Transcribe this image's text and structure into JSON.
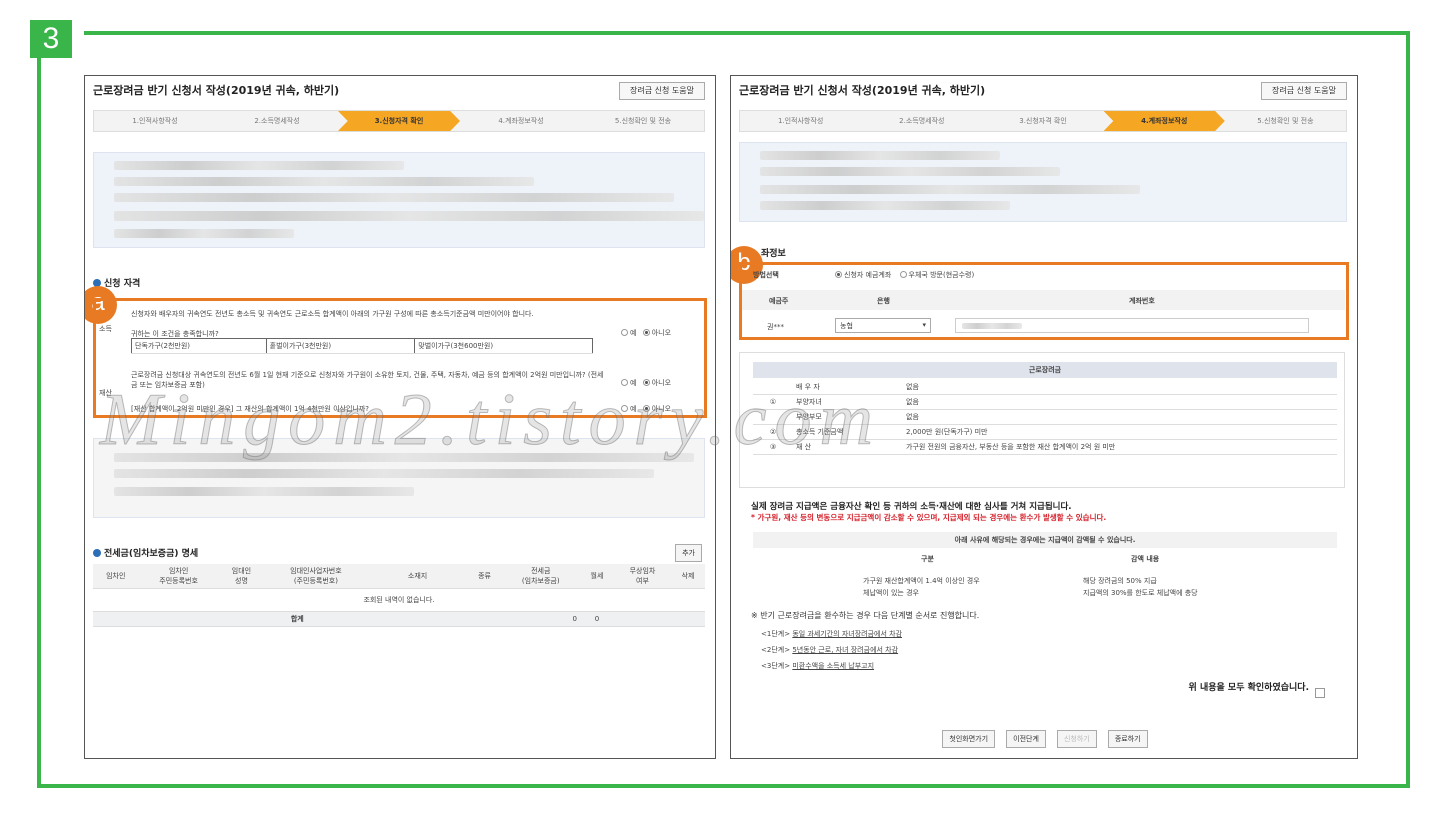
{
  "step_badge": "3",
  "left": {
    "title": "근로장려금 반기 신청서 작성(2019년 귀속, 하반기)",
    "help_button": "장려금 신청 도움말",
    "steps": [
      "1.인적사항작성",
      "2.소득명세작성",
      "3.신청자격 확인",
      "4.계좌정보작성",
      "5.신청확인 및 전송"
    ],
    "active_step": 2,
    "section_qualification": "신청 자격",
    "callout": "a",
    "income_label": "소득",
    "income_q": "신청자와 배우자의 귀속연도 전년도 총소득 및 귀속연도 근로소득 합계액이 아래의 가구원 구성에 따른 총소득기준금액 미만이어야 합니다.",
    "income_q2": "귀하는 이 조건을 충족합니까?",
    "household_cols": [
      "단독가구(2천만원)",
      "홑벌이가구(3천만원)",
      "맞벌이가구(3천600만원)"
    ],
    "property_label": "재산",
    "property_q": "근로장려금 신청대상 귀속연도의 전년도 6월 1일 현재 기준으로 신청자와 가구원이 소유한 토지, 건물, 주택, 자동차, 예금 등의 합계액이 2억원 미만입니까? (전세금 또는 임차보증금 포함)",
    "property_q2": "[재산 합계액이 2억원 미만인 경우] 그 재산의 합계액이 1억 4천만원 이상입니까?",
    "yes": "예",
    "no": "아니오",
    "section_lease": "전세금(임차보증금) 명세",
    "add_button": "추가",
    "lease_cols": [
      "임차인",
      "임차인\n주민등록번호",
      "임대인\n성명",
      "임대인사업자번호\n(주민등록번호)",
      "소재지",
      "종류",
      "전세금\n(임차보증금)",
      "월세",
      "무상임차\n여부",
      "삭제"
    ],
    "lease_empty": "조회된 내역이 없습니다.",
    "total_label": "합계",
    "total_v1": "0",
    "total_v2": "0"
  },
  "right": {
    "title": "근로장려금 반기 신청서 작성(2019년 귀속, 하반기)",
    "help_button": "장려금 신청 도움말",
    "steps": [
      "1.인적사항작성",
      "2.소득명세작성",
      "3.신청자격 확인",
      "4.계좌정보작성",
      "5.신청확인 및 전송"
    ],
    "active_step": 3,
    "account_section": "좌정보",
    "callout": "b",
    "method_label": "방법선택",
    "method_opt1": "신청자 예금계좌",
    "method_opt2": "우체국 방문(현금수령)",
    "depositor_col": "예금주",
    "bank_col": "은행",
    "account_col": "계좌번호",
    "depositor_val": "권***",
    "bank_val": "농협",
    "summary_header": "근로장려금",
    "summary_rows": [
      {
        "no": "",
        "label": "배 우 자",
        "value": "없음"
      },
      {
        "no": "①",
        "label": "부양자녀",
        "value": "없음"
      },
      {
        "no": "",
        "label": "부양부모",
        "value": "없음"
      },
      {
        "no": "②",
        "label": "총소득 기준금액",
        "value": "2,000만 원(단독가구) 미만"
      },
      {
        "no": "③",
        "label": "재    산",
        "value": "가구원 전원의 금융자산, 부동산 등을 포함한 재산 합계액이 2억 원 미만"
      }
    ],
    "notice1": "실제 장려금 지급액은 금융자산 확인 등 귀하의 소득·재산에 대한 심사를 거쳐 지급됩니다.",
    "notice2": "* 가구원, 재산 등의 변동으로 지급금액이 감소할 수 있으며, 지급제외 되는 경우에는 환수가 발생할 수 있습니다.",
    "reduce_title": "아래 사유에 해당되는 경우에는 지급액이 감액될 수 있습니다.",
    "reduce_col1": "구분",
    "reduce_col2": "감액 내용",
    "reduce_r1_c1": "가구원 재산합계액이 1.4억 이상인 경우",
    "reduce_r1_c2": "해당 장려금의 50% 지급",
    "reduce_r2_c1": "체납액이 있는 경우",
    "reduce_r2_c2": "지급액의 30%를 한도로 체납액에 충당",
    "refund_title": "※ 반기 근로장려금을 환수하는 경우 다음 단계별 순서로 진행합니다.",
    "stage1_label": "<1단계>",
    "stage1_text": "동일 과세기간의 자녀장려금에서 차감",
    "stage2_label": "<2단계>",
    "stage2_text": "5년동안 근로, 자녀 장려금에서 차감",
    "stage3_label": "<3단계>",
    "stage3_text": "미환수액을 소득세 납부고지",
    "confirm_text": "위 내용을 모두 확인하였습니다.",
    "btn_first": "첫인화면가기",
    "btn_prev": "이전단계",
    "btn_next": "신청하기",
    "btn_end": "종료하기"
  },
  "watermark": "Mingom2.tistory.com"
}
